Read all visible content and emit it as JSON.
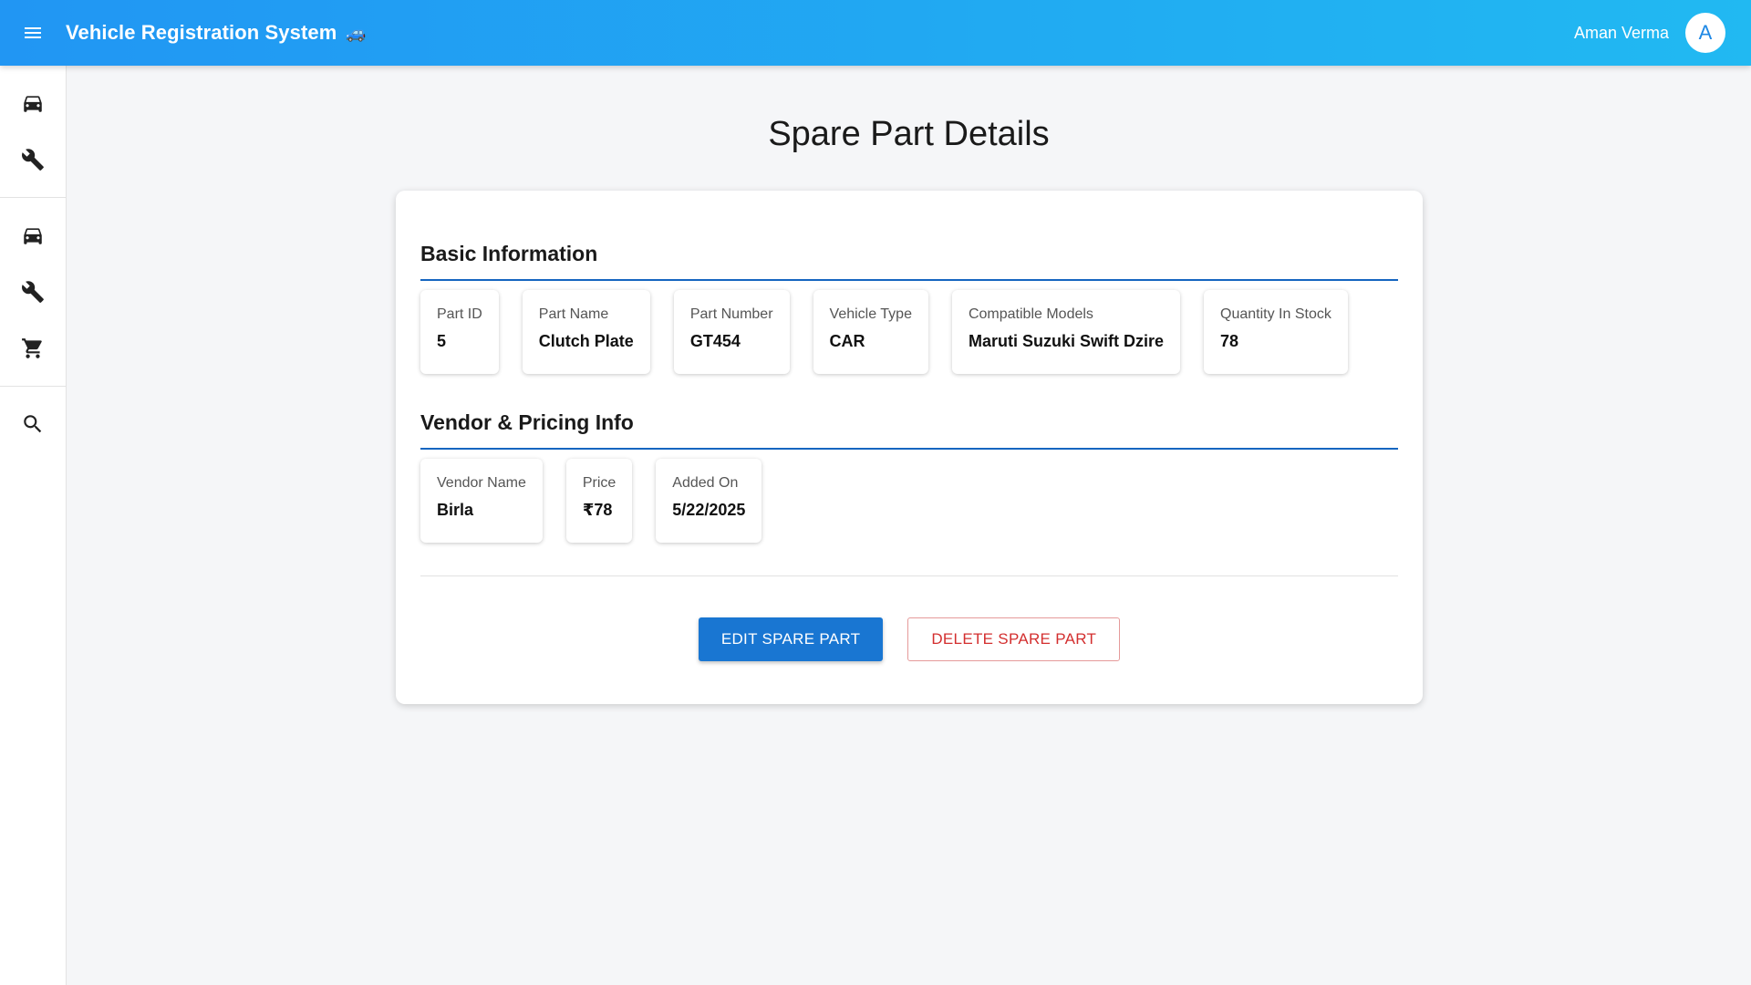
{
  "appbar": {
    "title": "Vehicle Registration System",
    "title_emoji": "🚙",
    "user_name": "Aman Verma",
    "avatar_initial": "A"
  },
  "sidebar": {
    "groups": [
      [
        "car-icon",
        "wrench-icon"
      ],
      [
        "car-icon",
        "wrench-icon",
        "cart-icon"
      ],
      [
        "search-icon"
      ]
    ]
  },
  "main": {
    "page_title": "Spare Part Details",
    "basic_info": {
      "title": "Basic Information",
      "fields": [
        {
          "label": "Part ID",
          "value": "5"
        },
        {
          "label": "Part Name",
          "value": "Clutch Plate"
        },
        {
          "label": "Part Number",
          "value": "GT454"
        },
        {
          "label": "Vehicle Type",
          "value": "CAR"
        },
        {
          "label": "Compatible Models",
          "value": "Maruti Suzuki Swift Dzire"
        },
        {
          "label": "Quantity In Stock",
          "value": "78"
        }
      ]
    },
    "vendor_info": {
      "title": "Vendor & Pricing Info",
      "fields": [
        {
          "label": "Vendor Name",
          "value": "Birla"
        },
        {
          "label": "Price",
          "value": "₹78"
        },
        {
          "label": "Added On",
          "value": "5/22/2025"
        }
      ]
    },
    "actions": {
      "edit_label": "EDIT SPARE PART",
      "delete_label": "DELETE SPARE PART"
    }
  },
  "colors": {
    "appbar_start": "#2196f3",
    "appbar_end": "#21b9f2",
    "primary": "#1976d2",
    "danger": "#d32f2f",
    "section_rule": "#1565c0"
  }
}
